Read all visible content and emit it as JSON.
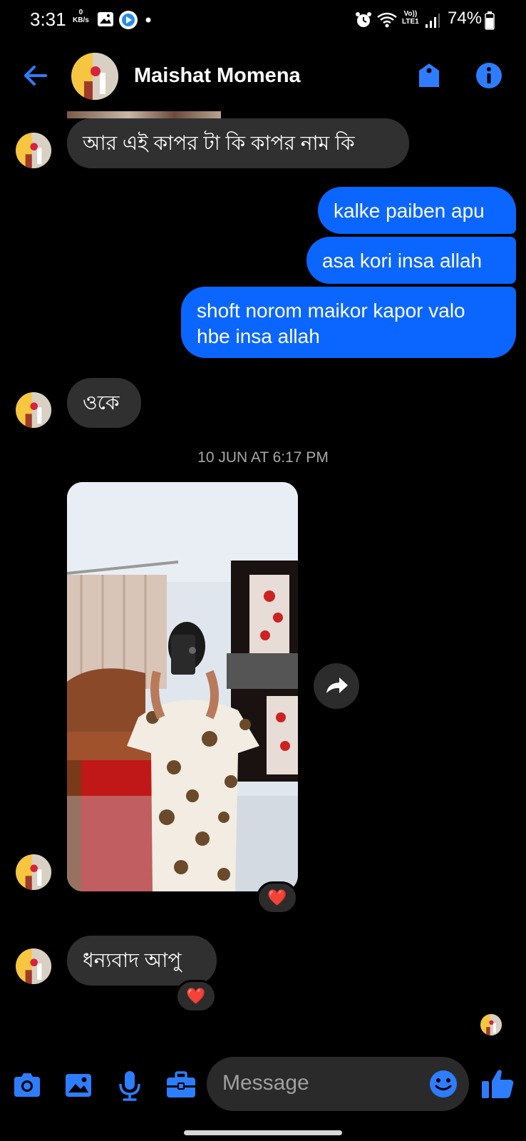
{
  "status_bar": {
    "time": "3:31",
    "data_rate_value": "0",
    "data_rate_unit": "KB/s",
    "network_label_top": "Vo))",
    "network_label_bottom": "LTE1",
    "battery": "74%"
  },
  "header": {
    "contact_name": "Maishat Momena"
  },
  "messages": [
    {
      "direction": "incoming",
      "text": "আর এই কাপর টা কি কাপর নাম কি"
    },
    {
      "direction": "outgoing",
      "text": "kalke paiben apu"
    },
    {
      "direction": "outgoing",
      "text": "asa kori insa allah"
    },
    {
      "direction": "outgoing",
      "text": "shoft norom maikor kapor valo hbe insa allah"
    },
    {
      "direction": "incoming",
      "text": "ওকে"
    },
    {
      "direction": "incoming",
      "text": "ধন্যবাদ আপু"
    }
  ],
  "timestamp": "10 JUN AT 6:17 PM",
  "reactions": [
    "❤️",
    "❤️"
  ],
  "composer": {
    "placeholder": "Message"
  },
  "colors": {
    "accent": "#0a66ff",
    "incoming_bubble": "#303030",
    "background": "#000000"
  }
}
